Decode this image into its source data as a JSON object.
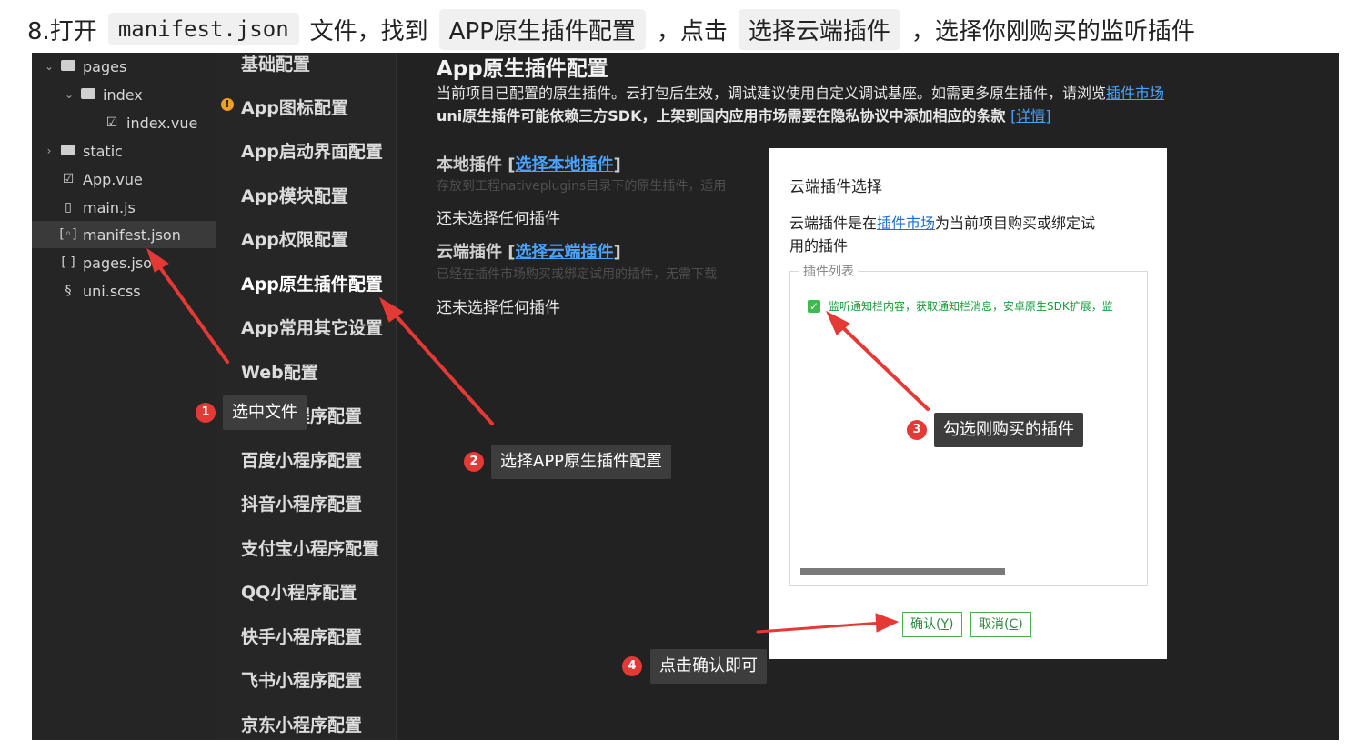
{
  "instruction": {
    "prefix": "8.打开",
    "file": "manifest.json",
    "part2": "文件，找到",
    "section": "APP原生插件配置",
    "part3": "，点击",
    "button": "选择云端插件",
    "part4": "，选择你刚购买的监听插件"
  },
  "file_tree": {
    "items": [
      {
        "label": "pages",
        "type": "folder",
        "expanded": true
      },
      {
        "label": "index",
        "type": "folder",
        "expanded": true
      },
      {
        "label": "index.vue",
        "type": "vue-file"
      },
      {
        "label": "static",
        "type": "folder",
        "expanded": false
      },
      {
        "label": "App.vue",
        "type": "vue-file"
      },
      {
        "label": "main.js",
        "type": "js-file"
      },
      {
        "label": "manifest.json",
        "type": "json-file",
        "selected": true
      },
      {
        "label": "pages.json",
        "type": "json-file"
      },
      {
        "label": "uni.scss",
        "type": "scss-file"
      }
    ]
  },
  "menu": {
    "items": [
      {
        "label": "基础配置"
      },
      {
        "label": "App图标配置",
        "warning": true
      },
      {
        "label": "App启动界面配置"
      },
      {
        "label": "App模块配置"
      },
      {
        "label": "App权限配置"
      },
      {
        "label": "App原生插件配置",
        "active": true
      },
      {
        "label": "App常用其它设置"
      },
      {
        "label": "Web配置"
      },
      {
        "label": "微信小程序配置"
      },
      {
        "label": "百度小程序配置"
      },
      {
        "label": "抖音小程序配置"
      },
      {
        "label": "支付宝小程序配置"
      },
      {
        "label": "QQ小程序配置"
      },
      {
        "label": "快手小程序配置"
      },
      {
        "label": "飞书小程序配置"
      },
      {
        "label": "京东小程序配置"
      }
    ],
    "warning_glyph": "!"
  },
  "main": {
    "title": "App原生插件配置",
    "desc1": "当前项目已配置的原生插件。云打包后生效，调试建议使用自定义调试基座。如需更多原生插件，请浏览",
    "desc1_link": "插件市场",
    "desc2": "uni原生插件可能依赖三方SDK，上架到国内应用市场需要在隐私协议中添加相应的条款",
    "desc2_link": "[详情]",
    "local_label": "本地插件 [",
    "local_link": "选择本地插件",
    "local_close": "]",
    "local_hint": "存放到工程nativeplugins目录下的原生插件，适用",
    "local_none": "还未选择任何插件",
    "cloud_label": "云端插件 [",
    "cloud_link": "选择云端插件",
    "cloud_close": "]",
    "cloud_hint": "已经在插件市场购买或绑定试用的插件，无需下载",
    "cloud_none": "还未选择任何插件"
  },
  "dialog": {
    "title": "云端插件选择",
    "desc_pre": "云端插件是在",
    "desc_link": "插件市场",
    "desc_post1": "为当前项目购买或绑定试",
    "desc_post2": "用的插件",
    "legend": "插件列表",
    "plugin": "监听通知栏内容，获取通知栏消息，安卓原生SDK扩展，监",
    "plugin_checked": true,
    "confirm": "确认(",
    "confirm_key": "Y",
    "confirm_close": ")",
    "cancel": "取消(",
    "cancel_key": "C",
    "cancel_close": ")"
  },
  "annotations": [
    {
      "num": "1",
      "text": "选中文件"
    },
    {
      "num": "2",
      "text": "选择APP原生插件配置"
    },
    {
      "num": "3",
      "text": "勾选刚购买的插件"
    },
    {
      "num": "4",
      "text": "点击确认即可"
    }
  ],
  "colors": {
    "link": "#4aa3ff",
    "arrow": "#e53935",
    "check": "#3fb950",
    "dialog_button": "#2e8b3e"
  }
}
